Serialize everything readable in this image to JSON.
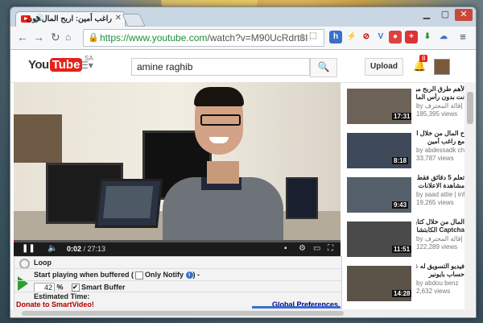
{
  "window": {
    "tab_title": "راغب أمين: اربح المال دون",
    "url_host": "https://www.youtube.com",
    "url_path": "/watch?v=M90UcRdrt3I"
  },
  "youtube": {
    "logo_you": "You",
    "logo_tube": "Tube",
    "logo_region": "SA",
    "search_query": "amine raghib",
    "upload_label": "Upload",
    "notification_count": "8"
  },
  "player": {
    "current_time": "0:02",
    "duration": "27:13",
    "progress": 0.0012
  },
  "smartvideo": {
    "loop_label": "Loop",
    "start_playing_label": "Start playing when buffered (",
    "only_notify_label": "Only Notify",
    "after_info": ") -",
    "percent_value": "42",
    "percent_sign": "%",
    "smart_buffer_label": "Smart Buffer",
    "estimated_time_label": "Estimated Time:",
    "donate_label": "Donate to SmartVideo!",
    "global_prefs_label": "Global Preferences"
  },
  "sidebar": {
    "items": [
      {
        "title1": "لأهم طرق الربح من",
        "title2": "نت بدون رأس المال",
        "by": "by إقالة المحترف | Alm",
        "views": "185,395 views",
        "duration": "17:31"
      },
      {
        "title1": "ح المال من خلال الفيسبوك",
        "title2": "مع راغب أمين",
        "by": "by abdessadk cha",
        "views": "33,787 views",
        "duration": "8:18"
      },
      {
        "title1": "تعلم 5 دقائق فقط",
        "title2": "مشاهدة الاعلانات",
        "by": "by saad attie | info",
        "views": "19,265 views",
        "duration": "9:43"
      },
      {
        "title1": "المال من خلال كتابة",
        "title2": "Captcha الكابتشا",
        "by": "by إقالة المحترف | Alm",
        "views": "122,289 views",
        "duration": "11:51"
      },
      {
        "title1": "فيديو التسويق له عن",
        "title2": "حساب بايونير",
        "by": "by abdou benz",
        "views": "2,632 views",
        "duration": "14:28"
      }
    ]
  },
  "colors": {
    "accent": "#e62117",
    "play_green": "#2aa12a",
    "link_blue": "#000080"
  }
}
